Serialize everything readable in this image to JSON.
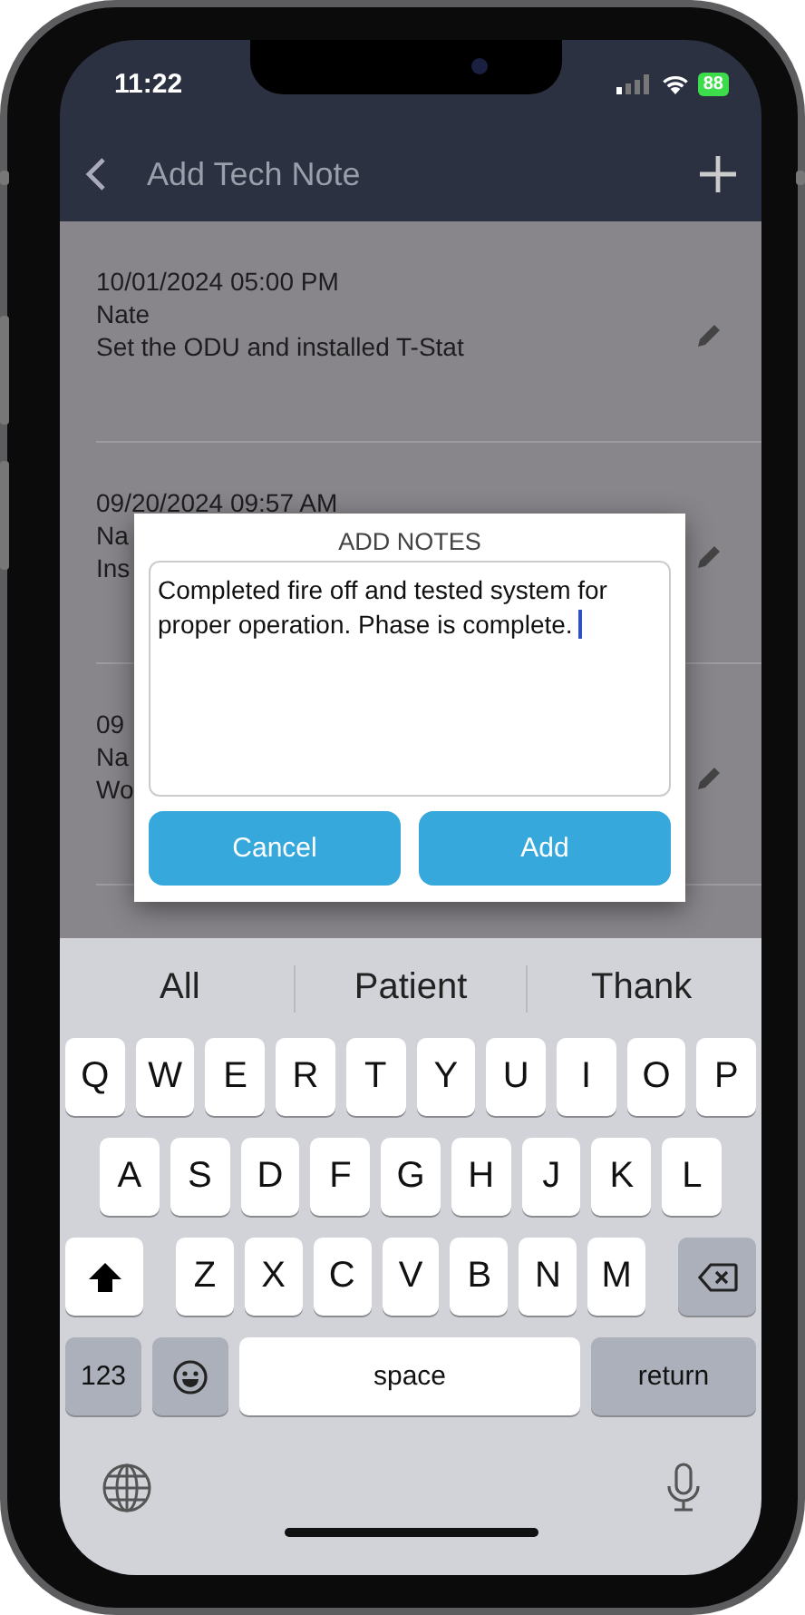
{
  "status_bar": {
    "time": "11:22",
    "battery": "88"
  },
  "nav": {
    "title": "Add Tech Note"
  },
  "notes": [
    {
      "date": "10/01/2024 05:00 PM",
      "author": "Nate",
      "text": "Set the ODU and installed T-Stat"
    },
    {
      "date": "09/20/2024 09:57 AM",
      "author": "Na",
      "text": "Ins"
    },
    {
      "date": "09",
      "author": "Na",
      "text": "Wo"
    }
  ],
  "dialog": {
    "title": "ADD NOTES",
    "value": "Completed fire off and tested system for proper operation. Phase is complete.",
    "buttons": [
      "Cancel",
      "Add"
    ]
  },
  "keyboard": {
    "suggestions": [
      "All",
      "Patient",
      "Thank"
    ],
    "rows": [
      [
        "Q",
        "W",
        "E",
        "R",
        "T",
        "Y",
        "U",
        "I",
        "O",
        "P"
      ],
      [
        "A",
        "S",
        "D",
        "F",
        "G",
        "H",
        "J",
        "K",
        "L"
      ],
      [
        "Z",
        "X",
        "C",
        "V",
        "B",
        "N",
        "M"
      ]
    ],
    "numbers_key": "123",
    "space_key": "space",
    "return_key": "return"
  }
}
